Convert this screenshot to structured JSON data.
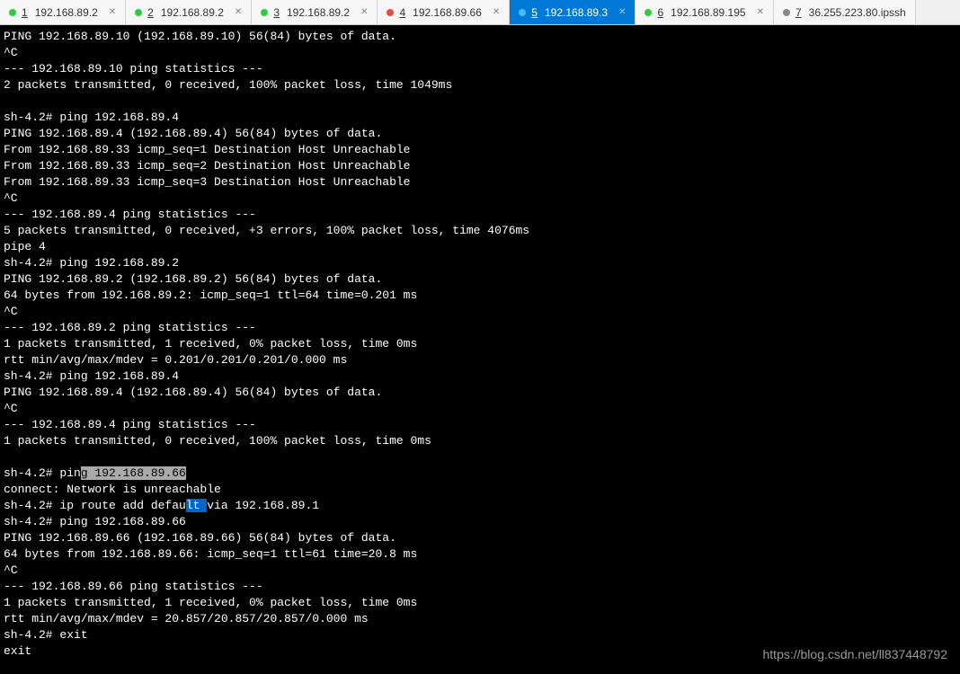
{
  "tabs": [
    {
      "num": "1",
      "label": "192.168.89.2",
      "status": "green",
      "active": false,
      "closeable": true
    },
    {
      "num": "2",
      "label": "192.168.89.2",
      "status": "green",
      "active": false,
      "closeable": true
    },
    {
      "num": "3",
      "label": "192.168.89.2",
      "status": "green",
      "active": false,
      "closeable": true
    },
    {
      "num": "4",
      "label": "192.168.89.66",
      "status": "red",
      "active": false,
      "closeable": true
    },
    {
      "num": "5",
      "label": "192.168.89.3",
      "status": "cyan",
      "active": true,
      "closeable": true
    },
    {
      "num": "6",
      "label": "192.168.89.195",
      "status": "green",
      "active": false,
      "closeable": true
    },
    {
      "num": "7",
      "label": "36.255.223.80.ipssh",
      "status": "gray",
      "active": false,
      "closeable": false
    }
  ],
  "terminal": {
    "lines": [
      "PING 192.168.89.10 (192.168.89.10) 56(84) bytes of data.",
      "^C",
      "--- 192.168.89.10 ping statistics ---",
      "2 packets transmitted, 0 received, 100% packet loss, time 1049ms",
      "",
      "sh-4.2# ping 192.168.89.4",
      "PING 192.168.89.4 (192.168.89.4) 56(84) bytes of data.",
      "From 192.168.89.33 icmp_seq=1 Destination Host Unreachable",
      "From 192.168.89.33 icmp_seq=2 Destination Host Unreachable",
      "From 192.168.89.33 icmp_seq=3 Destination Host Unreachable",
      "^C",
      "--- 192.168.89.4 ping statistics ---",
      "5 packets transmitted, 0 received, +3 errors, 100% packet loss, time 4076ms",
      "pipe 4",
      "sh-4.2# ping 192.168.89.2",
      "PING 192.168.89.2 (192.168.89.2) 56(84) bytes of data.",
      "64 bytes from 192.168.89.2: icmp_seq=1 ttl=64 time=0.201 ms",
      "^C",
      "--- 192.168.89.2 ping statistics ---",
      "1 packets transmitted, 1 received, 0% packet loss, time 0ms",
      "rtt min/avg/max/mdev = 0.201/0.201/0.201/0.000 ms",
      "sh-4.2# ping 192.168.89.4",
      "PING 192.168.89.4 (192.168.89.4) 56(84) bytes of data.",
      "^C",
      "--- 192.168.89.4 ping statistics ---",
      "1 packets transmitted, 0 received, 100% packet loss, time 0ms",
      ""
    ],
    "highlighted_line": {
      "prefix": "sh-4.2# pin",
      "highlight": "g 192.168.89.66",
      "suffix": ""
    },
    "after_hl": [
      "connect: Network is unreachable"
    ],
    "route_line": {
      "prefix": "sh-4.2# ip route add defau",
      "hl": "lt ",
      "suffix": "via 192.168.89.1"
    },
    "after_route": [
      "sh-4.2# ping 192.168.89.66",
      "PING 192.168.89.66 (192.168.89.66) 56(84) bytes of data.",
      "64 bytes from 192.168.89.66: icmp_seq=1 ttl=61 time=20.8 ms",
      "^C",
      "--- 192.168.89.66 ping statistics ---",
      "1 packets transmitted, 1 received, 0% packet loss, time 0ms",
      "rtt min/avg/max/mdev = 20.857/20.857/20.857/0.000 ms",
      "sh-4.2# exit",
      "exit"
    ]
  },
  "watermark": "https://blog.csdn.net/ll837448792"
}
